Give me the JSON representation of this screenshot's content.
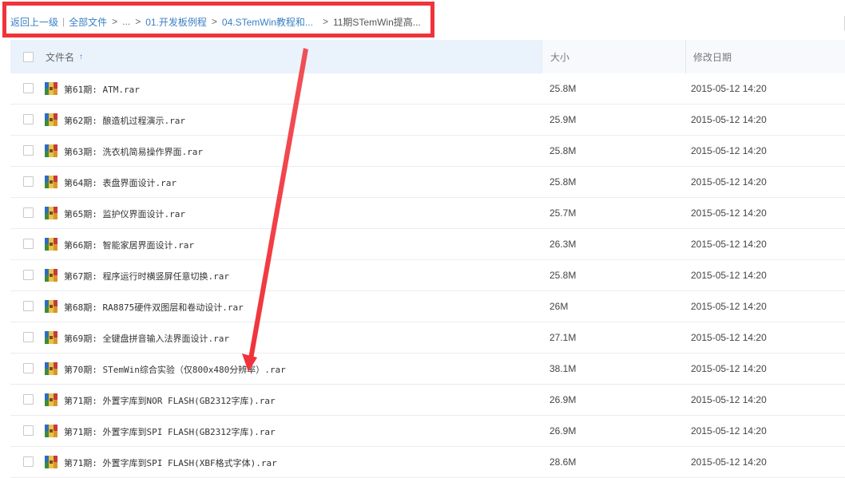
{
  "breadcrumb": {
    "back": "返回上一级",
    "all_files": "全部文件",
    "ellipsis": "...",
    "folder1": "01.开发板例程",
    "folder2": "04.STemWin教程和...",
    "current": "11期STemWin提高..."
  },
  "table": {
    "header_name": "文件名",
    "header_size": "大小",
    "header_date": "修改日期",
    "sort_indicator": "↑"
  },
  "files": [
    {
      "name": "第61期: ATM.rar",
      "size": "25.8M",
      "date": "2015-05-12 14:20"
    },
    {
      "name": "第62期: 酿造机过程演示.rar",
      "size": "25.9M",
      "date": "2015-05-12 14:20"
    },
    {
      "name": "第63期: 洗衣机简易操作界面.rar",
      "size": "25.8M",
      "date": "2015-05-12 14:20"
    },
    {
      "name": "第64期: 表盘界面设计.rar",
      "size": "25.8M",
      "date": "2015-05-12 14:20"
    },
    {
      "name": "第65期: 监护仪界面设计.rar",
      "size": "25.7M",
      "date": "2015-05-12 14:20"
    },
    {
      "name": "第66期: 智能家居界面设计.rar",
      "size": "26.3M",
      "date": "2015-05-12 14:20"
    },
    {
      "name": "第67期: 程序运行时横竖屏任意切换.rar",
      "size": "25.8M",
      "date": "2015-05-12 14:20"
    },
    {
      "name": "第68期: RA8875硬件双图层和卷动设计.rar",
      "size": "26M",
      "date": "2015-05-12 14:20"
    },
    {
      "name": "第69期: 全键盘拼音输入法界面设计.rar",
      "size": "27.1M",
      "date": "2015-05-12 14:20"
    },
    {
      "name": "第70期: STemWin综合实验（仅800x480分辨率）.rar",
      "size": "38.1M",
      "date": "2015-05-12 14:20"
    },
    {
      "name": "第71期: 外置字库到NOR FLASH(GB2312字库).rar",
      "size": "26.9M",
      "date": "2015-05-12 14:20"
    },
    {
      "name": "第71期: 外置字库到SPI FLASH(GB2312字库).rar",
      "size": "26.9M",
      "date": "2015-05-12 14:20"
    },
    {
      "name": "第71期: 外置字库到SPI FLASH(XBF格式字体).rar",
      "size": "28.6M",
      "date": "2015-05-12 14:20"
    }
  ],
  "icons": {
    "file_icon": "rar-archive-icon",
    "sort_icon": "sort-ascending-icon"
  },
  "colors": {
    "annotation_red": "#f0333a",
    "link_blue": "#3a7fc4",
    "header_selected_bg": "#eaf3fc"
  }
}
